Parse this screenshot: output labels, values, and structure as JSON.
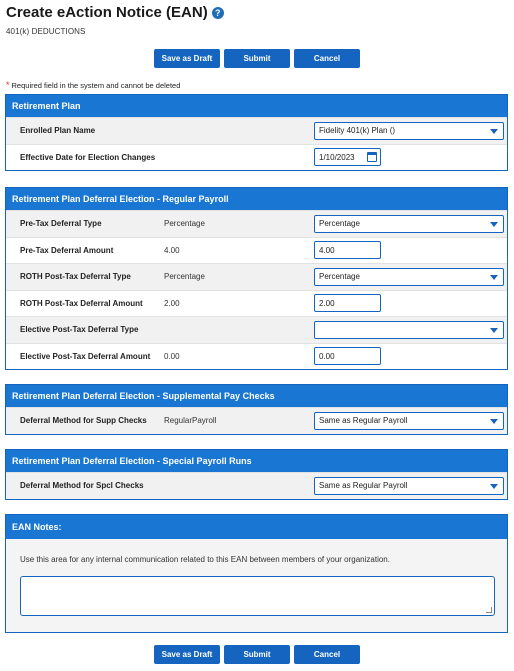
{
  "header": {
    "title": "Create eAction Notice (EAN)",
    "subtitle": "401(k) DEDUCTIONS",
    "help_icon": "question-circle-icon"
  },
  "actions": {
    "save_draft": "Save as Draft",
    "submit": "Submit",
    "cancel": "Cancel"
  },
  "required_note": {
    "star": "*",
    "text": "Required field in the system and cannot be deleted"
  },
  "retirement_plan": {
    "title": "Retirement Plan",
    "enrolled_plan_label": "Enrolled Plan Name",
    "enrolled_plan_value": "Fidelity 401(k) Plan ()",
    "effective_date_label": "Effective Date for Election Changes",
    "effective_date_value": "1/10/2023"
  },
  "regular_payroll": {
    "title": "Retirement Plan Deferral Election - Regular Payroll",
    "rows": [
      {
        "label": "Pre-Tax Deferral Type",
        "current": "Percentage",
        "value": "Percentage"
      },
      {
        "label": "Pre-Tax Deferral Amount",
        "current": "4.00",
        "value": "4.00"
      },
      {
        "label": "ROTH Post-Tax Deferral Type",
        "current": "Percentage",
        "value": "Percentage"
      },
      {
        "label": "ROTH Post-Tax Deferral Amount",
        "current": "2.00",
        "value": "2.00"
      },
      {
        "label": "Elective Post-Tax Deferral Type",
        "current": "",
        "value": ""
      },
      {
        "label": "Elective Post-Tax Deferral Amount",
        "current": "0.00",
        "value": "0.00"
      }
    ]
  },
  "supplemental": {
    "title": "Retirement Plan Deferral Election - Supplemental Pay Checks",
    "label": "Deferral Method for Supp Checks",
    "current": "RegularPayroll",
    "value": "Same as Regular Payroll"
  },
  "special": {
    "title": "Retirement Plan Deferral Election - Special Payroll Runs",
    "label": "Deferral Method for Spcl Checks",
    "current": "",
    "value": "Same as Regular Payroll"
  },
  "notes": {
    "title": "EAN Notes:",
    "description": "Use this area for any internal communication related to this EAN between members of your organization.",
    "value": ""
  }
}
